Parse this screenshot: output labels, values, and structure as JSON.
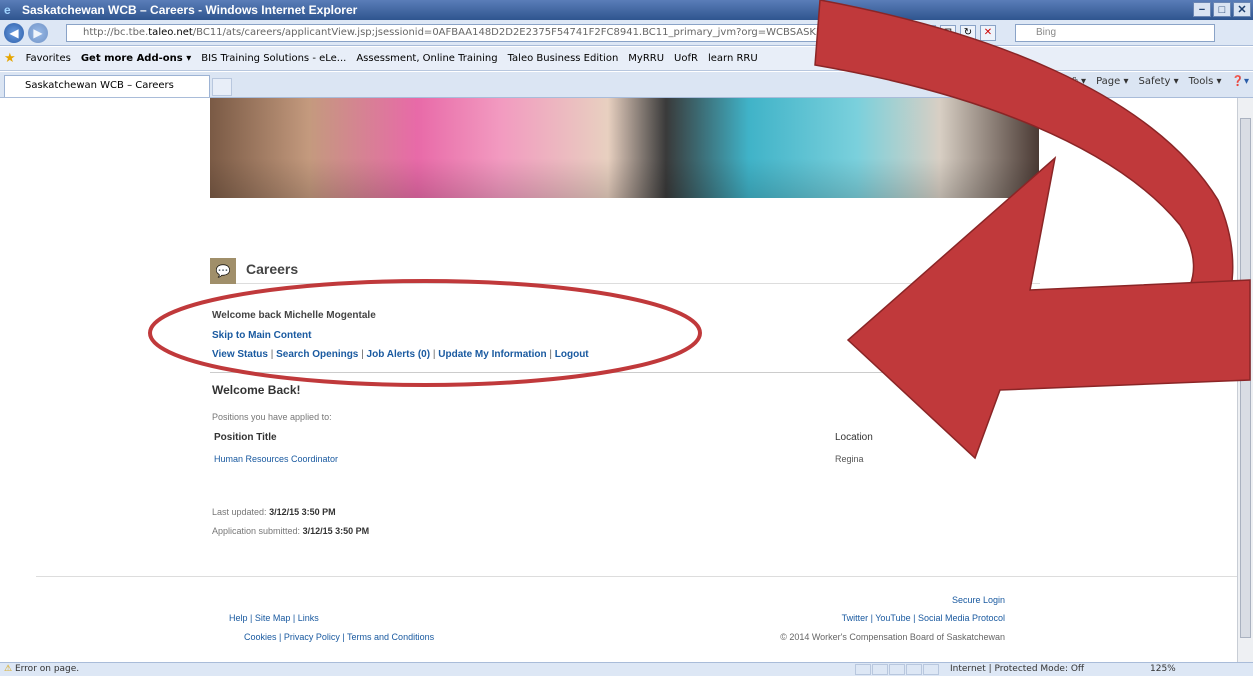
{
  "window": {
    "title": "Saskatchewan WCB – Careers - Windows Internet Explorer",
    "controls": [
      "−",
      "□",
      "✕"
    ]
  },
  "browser": {
    "url_prefix": "http://bc.tbe.",
    "url_domain": "taleo.net",
    "url_rest": "/BC11/ats/careers/applicantView.jsp;jsessionid=0AFBAA148D2D2E2375F54741F2FC8941.BC11_primary_jvm?org=WCBSASK2&cws=1",
    "search_placeholder": "Bing",
    "favorites_label": "Favorites",
    "favorites": [
      "Get more Add-ons ▾",
      "BIS Training Solutions - eLe...",
      "Assessment, Online Training",
      "Taleo Business Edition",
      "MyRRU",
      "UofR",
      "learn RRU"
    ],
    "tab_label": "Saskatchewan WCB – Careers",
    "commands": [
      "Page ▾",
      "Safety ▾",
      "Tools ▾"
    ]
  },
  "page": {
    "section_title": "Careers",
    "welcome_name": "Welcome back Michelle Mogentale",
    "skip_link": "Skip to Main Content",
    "nav_links": [
      "View Status",
      "Search Openings",
      "Job Alerts (0)",
      "Update My Information",
      "Logout"
    ],
    "welcome_title": "Welcome Back!",
    "applied_label": "Positions you have applied to:",
    "table": {
      "headers": [
        "Position Title",
        "Location"
      ],
      "rows": [
        [
          "Human Resources Coordinator",
          "Regina"
        ]
      ]
    },
    "last_updated_label": "Last updated:",
    "last_updated_value": "3/12/15 3:50 PM",
    "submitted_label": "Application submitted:",
    "submitted_value": "3/12/15 3:50 PM"
  },
  "footer": {
    "left_line1": "Help | Site Map | Links",
    "left_line2": "Cookies | Privacy Policy | Terms and Conditions",
    "secure_login": "Secure Login",
    "social": "Twitter | YouTube | Social Media Protocol",
    "copyright": "© 2014 Worker's Compensation Board of Saskatchewan"
  },
  "status": {
    "message": "Error on page.",
    "zone": "Internet | Protected Mode: Off",
    "zoom": "125%"
  },
  "annotation_color": "#c0393b"
}
